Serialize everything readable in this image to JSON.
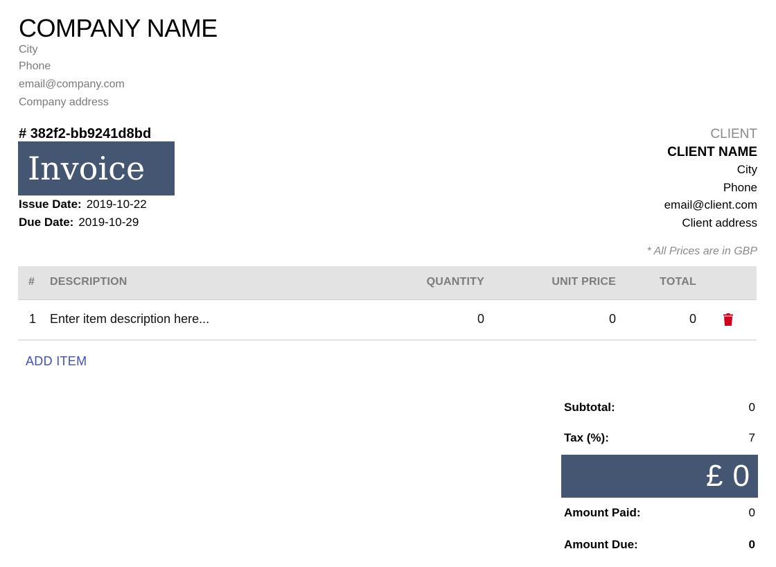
{
  "company": {
    "name": "COMPANY NAME",
    "city": "City",
    "phone": "Phone",
    "email": "email@company.com",
    "address": "Company address"
  },
  "invoice": {
    "number_prefix": "#",
    "number": "382f2-bb9241d8bd",
    "title": "Invoice",
    "issue_date_label": "Issue Date:",
    "issue_date": "2019-10-22",
    "due_date_label": "Due Date:",
    "due_date": "2019-10-29",
    "banner_color": "#445672"
  },
  "client": {
    "caption": "CLIENT",
    "name": "CLIENT NAME",
    "city": "City",
    "phone": "Phone",
    "email": "email@client.com",
    "address": "Client address"
  },
  "currency_note": "* All Prices are in GBP",
  "items_table": {
    "headers": [
      "#",
      "DESCRIPTION",
      "QUANTITY",
      "UNIT PRICE",
      "TOTAL"
    ],
    "rows": [
      {
        "index": "1",
        "description": "Enter item description here...",
        "quantity": "0",
        "unit_price": "0",
        "total": "0",
        "delete_icon": "trash-icon"
      }
    ],
    "delete_color": "#d0021b"
  },
  "add_item_label": "ADD ITEM",
  "totals": {
    "subtotal_label": "Subtotal:",
    "subtotal": "0",
    "tax_label": "Tax (%):",
    "tax": "7",
    "grand_total_symbol": "£",
    "grand_total": "0",
    "amount_paid_label": "Amount Paid:",
    "amount_paid": "0",
    "amount_due_label": "Amount Due:",
    "amount_due": "0"
  }
}
